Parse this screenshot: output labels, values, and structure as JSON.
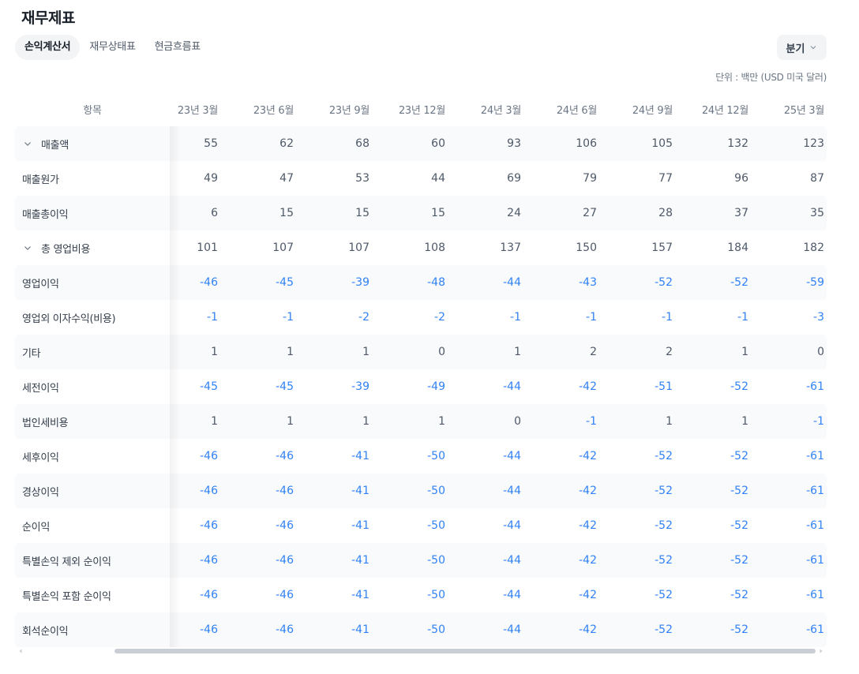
{
  "title": "재무제표",
  "tabs": [
    {
      "label": "손익계산서",
      "active": true
    },
    {
      "label": "재무상태표",
      "active": false
    },
    {
      "label": "현금흐름표",
      "active": false
    }
  ],
  "period_select": {
    "value": "분기",
    "icon": "chevron-down-icon"
  },
  "unit_note": "단위 : 백만 (USD 미국 달러)",
  "table": {
    "header_label": "항목",
    "columns": [
      "23년 3월",
      "23년 6월",
      "23년 9월",
      "23년 12월",
      "24년 3월",
      "24년 6월",
      "24년 9월",
      "24년 12월",
      "25년 3월"
    ],
    "rows": [
      {
        "label": "매출액",
        "expandable": true,
        "values": [
          "55",
          "62",
          "68",
          "60",
          "93",
          "106",
          "105",
          "132",
          "123"
        ]
      },
      {
        "label": "매출원가",
        "expandable": false,
        "values": [
          "49",
          "47",
          "53",
          "44",
          "69",
          "79",
          "77",
          "96",
          "87"
        ]
      },
      {
        "label": "매출총이익",
        "expandable": false,
        "values": [
          "6",
          "15",
          "15",
          "15",
          "24",
          "27",
          "28",
          "37",
          "35"
        ]
      },
      {
        "label": "총 영업비용",
        "expandable": true,
        "values": [
          "101",
          "107",
          "107",
          "108",
          "137",
          "150",
          "157",
          "184",
          "182"
        ]
      },
      {
        "label": "영업이익",
        "expandable": false,
        "values": [
          "-46",
          "-45",
          "-39",
          "-48",
          "-44",
          "-43",
          "-52",
          "-52",
          "-59"
        ]
      },
      {
        "label": "영업외 이자수익(비용)",
        "expandable": false,
        "values": [
          "-1",
          "-1",
          "-2",
          "-2",
          "-1",
          "-1",
          "-1",
          "-1",
          "-3"
        ]
      },
      {
        "label": "기타",
        "expandable": false,
        "values": [
          "1",
          "1",
          "1",
          "0",
          "1",
          "2",
          "2",
          "1",
          "0"
        ]
      },
      {
        "label": "세전이익",
        "expandable": false,
        "values": [
          "-45",
          "-45",
          "-39",
          "-49",
          "-44",
          "-42",
          "-51",
          "-52",
          "-61"
        ]
      },
      {
        "label": "법인세비용",
        "expandable": false,
        "values": [
          "1",
          "1",
          "1",
          "1",
          "0",
          "-1",
          "1",
          "1",
          "-1"
        ]
      },
      {
        "label": "세후이익",
        "expandable": false,
        "values": [
          "-46",
          "-46",
          "-41",
          "-50",
          "-44",
          "-42",
          "-52",
          "-52",
          "-61"
        ]
      },
      {
        "label": "경상이익",
        "expandable": false,
        "values": [
          "-46",
          "-46",
          "-41",
          "-50",
          "-44",
          "-42",
          "-52",
          "-52",
          "-61"
        ]
      },
      {
        "label": "순이익",
        "expandable": false,
        "values": [
          "-46",
          "-46",
          "-41",
          "-50",
          "-44",
          "-42",
          "-52",
          "-52",
          "-61"
        ]
      },
      {
        "label": "특별손익 제외 순이익",
        "expandable": false,
        "values": [
          "-46",
          "-46",
          "-41",
          "-50",
          "-44",
          "-42",
          "-52",
          "-52",
          "-61"
        ]
      },
      {
        "label": "특별손익 포함 순이익",
        "expandable": false,
        "values": [
          "-46",
          "-46",
          "-41",
          "-50",
          "-44",
          "-42",
          "-52",
          "-52",
          "-61"
        ]
      },
      {
        "label": "회석순이익",
        "expandable": false,
        "values": [
          "-46",
          "-46",
          "-41",
          "-50",
          "-44",
          "-42",
          "-52",
          "-52",
          "-61"
        ]
      }
    ]
  },
  "colors": {
    "negative": "#3182f6",
    "positive": "#4e5968",
    "row_shade": "#f9fafb",
    "tab_active_bg": "#f2f4f6"
  }
}
